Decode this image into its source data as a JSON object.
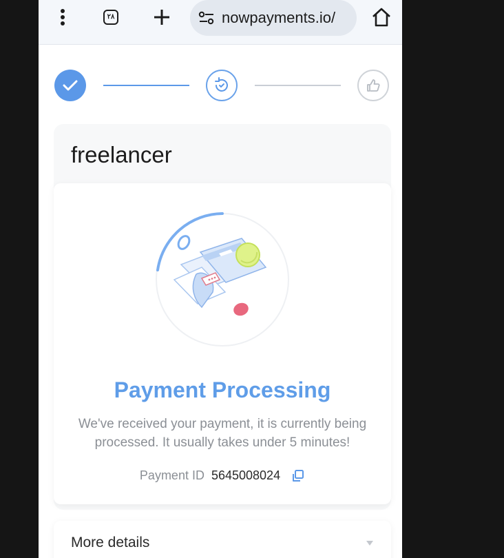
{
  "browser": {
    "tab_count": "٢٨",
    "url": "nowpayments.io/"
  },
  "stepper": {
    "steps": [
      {
        "state": "done",
        "icon": "check-icon"
      },
      {
        "state": "active",
        "icon": "refresh-icon"
      },
      {
        "state": "pending",
        "icon": "thumbs-up-icon"
      }
    ]
  },
  "merchant": {
    "name": "freelancer"
  },
  "payment": {
    "status_title": "Payment Processing",
    "status_desc": "We've received your payment, it is currently being processed. It usually takes under 5 minutes!",
    "id_label": "Payment ID",
    "id_value": "5645008024"
  },
  "more_details": {
    "label": "More details"
  },
  "colors": {
    "accent": "#5b98e8",
    "text": "#1c1c1c",
    "muted": "#8b8f95"
  }
}
